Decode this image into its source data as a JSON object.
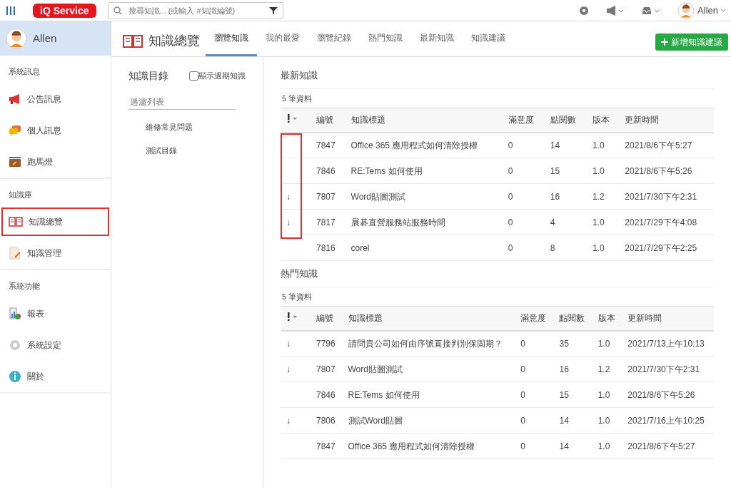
{
  "topbar": {
    "logo": "iQ Service",
    "search": {
      "placeholder": "搜尋知識... (或輸入 #知識編號)"
    },
    "user": "Allen"
  },
  "sidebar": {
    "user": "Allen",
    "sections": [
      {
        "title": "系統訊息",
        "items": [
          {
            "label": "公告訊息",
            "highlighted": false
          },
          {
            "label": "個人訊息",
            "highlighted": false
          },
          {
            "label": "跑馬燈",
            "highlighted": false
          }
        ]
      },
      {
        "title": "知識庫",
        "items": [
          {
            "label": "知識總覽",
            "highlighted": true
          },
          {
            "label": "知識管理",
            "highlighted": false
          }
        ]
      },
      {
        "title": "系統功能",
        "items": [
          {
            "label": "報表",
            "highlighted": false
          },
          {
            "label": "系統設定",
            "highlighted": false
          },
          {
            "label": "關於",
            "highlighted": false
          }
        ]
      }
    ]
  },
  "page": {
    "title": "知識總覽",
    "tabs": [
      {
        "label": "瀏覽知識",
        "selected": true
      },
      {
        "label": "我的最愛",
        "selected": false
      },
      {
        "label": "瀏覽紀錄",
        "selected": false
      },
      {
        "label": "熱門知識",
        "selected": false
      },
      {
        "label": "最新知識",
        "selected": false
      },
      {
        "label": "知識建議",
        "selected": false
      }
    ],
    "add_button": "新增知識建議"
  },
  "catalog": {
    "title": "知識目錄",
    "show_expired": {
      "label": "顯示過期知識",
      "checked": false
    },
    "filter": {
      "placeholder": "過濾列表"
    },
    "items": [
      "維修常見問題",
      "測試目錄"
    ]
  },
  "sections": [
    {
      "title": "最新知識",
      "count": "5 筆資料",
      "flag_column_highlighted": true,
      "columns": [
        "編號",
        "知識標題",
        "滿意度",
        "點閱數",
        "版本",
        "更新時間"
      ],
      "rows": [
        {
          "cells": [
            "7847",
            "Office 365 應用程式如何清除授權",
            "0",
            "14",
            "1.0",
            "2021/8/6下午5:27"
          ]
        },
        {
          "cells": [
            "7846",
            "RE:Tems 如何使用",
            "0",
            "15",
            "1.0",
            "2021/8/6下午5:26"
          ]
        },
        {
          "flag": "↓",
          "cells": [
            "7807",
            "Word貼圖測試",
            "0",
            "16",
            "1.2",
            "2021/7/30下午2:31"
          ]
        },
        {
          "flag": "↓",
          "cells": [
            "7817",
            "展碁直營服務站服務時間",
            "0",
            "4",
            "1.0",
            "2021/7/29下午4:08"
          ]
        },
        {
          "cells": [
            "7816",
            "corel",
            "0",
            "8",
            "1.0",
            "2021/7/29下午2:25"
          ]
        }
      ]
    },
    {
      "title": "熱門知識",
      "count": "5 筆資料",
      "flag_column_highlighted": false,
      "columns": [
        "編號",
        "知識標題",
        "滿意度",
        "點閱數",
        "版本",
        "更新時間"
      ],
      "rows": [
        {
          "flag": "↓",
          "cells": [
            "7796",
            "請問貴公司如何由序號直接判別保固期？",
            "0",
            "35",
            "1.0",
            "2021/7/13上午10:13"
          ]
        },
        {
          "flag": "↓",
          "cells": [
            "7807",
            "Word貼圖測試",
            "0",
            "16",
            "1.2",
            "2021/7/30下午2:31"
          ]
        },
        {
          "cells": [
            "7846",
            "RE:Tems 如何使用",
            "0",
            "15",
            "1.0",
            "2021/8/6下午5:26"
          ]
        },
        {
          "flag": "↓",
          "cells": [
            "7806",
            "測試Word貼圖",
            "0",
            "14",
            "1.0",
            "2021/7/16上午10:25"
          ]
        },
        {
          "cells": [
            "7847",
            "Office 365 應用程式如何清除授權",
            "0",
            "14",
            "1.0",
            "2021/8/6下午5:27"
          ]
        }
      ]
    }
  ]
}
